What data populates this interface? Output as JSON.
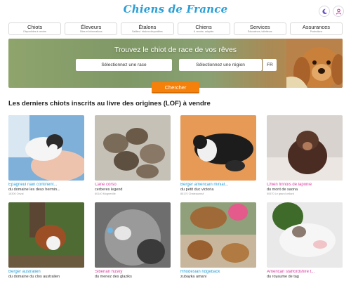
{
  "header": {
    "logo_text": "Chiens de France",
    "theme_icon": "moon-icon",
    "account_icon": "user-icon",
    "accent": "#2a9fd6"
  },
  "nav": [
    {
      "label": "Chiots",
      "sub": "Disponibles à vendre"
    },
    {
      "label": "Éleveurs",
      "sub": "Sites et informations"
    },
    {
      "label": "Étalons",
      "sub": "Saillies / étalons disponibles"
    },
    {
      "label": "Chiens",
      "sub": "À vendre, adoptés"
    },
    {
      "label": "Services",
      "sub": "Éducateurs, toiletteurs"
    },
    {
      "label": "Assurances",
      "sub": "Protections"
    }
  ],
  "hero": {
    "title": "Trouvez le chiot de race de vos rêves",
    "race_placeholder": "Sélectionnez une race",
    "region_placeholder": "Sélectionnez une région",
    "country": "FR",
    "search_label": "Chercher",
    "search_color": "#f5800a"
  },
  "section_title": "Les derniers chiots inscrits au livre des origines (LOF) à vendre",
  "puppies": [
    {
      "breed": "Epagneul nain continent...",
      "owner": "du domaine les deux hermin...",
      "location": "16300 Orival",
      "color": "blue"
    },
    {
      "breed": "Cane corso",
      "owner": "cerberes legend",
      "location": "60140 Mogneville",
      "color": "pink"
    },
    {
      "breed": "Berger américain miniat...",
      "owner": "du petit duc victoria",
      "location": "85170 Chateauneuf",
      "color": "blue"
    },
    {
      "breed": "Chien finnois de laponie",
      "owner": "du mont de saona",
      "location": "50570 Le grand cellard",
      "color": "pink"
    },
    {
      "breed": "Berger australien",
      "owner": "du domaine du clos australien",
      "location": "",
      "color": "blue"
    },
    {
      "breed": "Siberian husky",
      "owner": "du menez des glaziks",
      "location": "",
      "color": "pink"
    },
    {
      "breed": "Rhodesian ridgeback",
      "owner": "zubayka amani",
      "location": "",
      "color": "blue"
    },
    {
      "breed": "American staffordshire t...",
      "owner": "du royaume de tag",
      "location": "",
      "color": "pink"
    }
  ]
}
